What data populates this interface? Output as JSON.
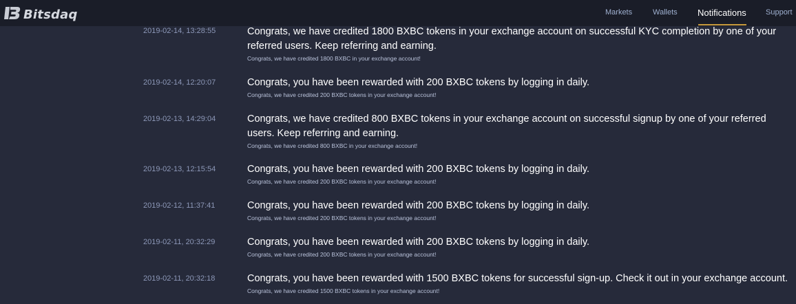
{
  "app": {
    "brand": "Bitsdaq",
    "nav": [
      "Markets",
      "Wallets",
      "Notifications",
      "Support"
    ],
    "active_nav": "Notifications"
  },
  "notifications": [
    {
      "date": "2019-02-14, 13:28:55",
      "message": "Congrats, we have credited 1800 BXBC tokens in your exchange account on successful KYC completion by one of your referred users. Keep referring and earning.",
      "detail": "Congrats, we have credited 1800 BXBC in your exchange account!"
    },
    {
      "date": "2019-02-14, 12:20:07",
      "message": "Congrats, you have been rewarded with 200 BXBC tokens by logging in daily.",
      "detail": "Congrats, we have credited 200 BXBC tokens in your exchange account!"
    },
    {
      "date": "2019-02-13, 14:29:04",
      "message": "Congrats, we have credited 800 BXBC tokens in your exchange account on successful signup by one of your referred users. Keep referring and earning.",
      "detail": "Congrats, we have credited 800 BXBC in your exchange account!"
    },
    {
      "date": "2019-02-13, 12:15:54",
      "message": "Congrats, you have been rewarded with 200 BXBC tokens by logging in daily.",
      "detail": "Congrats, we have credited 200 BXBC tokens in your exchange account!"
    },
    {
      "date": "2019-02-12, 11:37:41",
      "message": "Congrats, you have been rewarded with 200 BXBC tokens by logging in daily.",
      "detail": "Congrats, we have credited 200 BXBC tokens in your exchange account!"
    },
    {
      "date": "2019-02-11, 20:32:29",
      "message": "Congrats, you have been rewarded with 200 BXBC tokens by logging in daily.",
      "detail": "Congrats, we have credited 200 BXBC tokens in your exchange account!"
    },
    {
      "date": "2019-02-11, 20:32:18",
      "message": "Congrats, you have been rewarded with 1500 BXBC tokens for successful sign-up. Check it out in your exchange account.",
      "detail": "Congrats, we have credited 1500 BXBC tokens in your exchange account!"
    }
  ],
  "colors": {
    "background": "#262a3a",
    "topbar": "#1a1d28",
    "accent": "#c79a3c",
    "date_text": "#8d98b8"
  }
}
